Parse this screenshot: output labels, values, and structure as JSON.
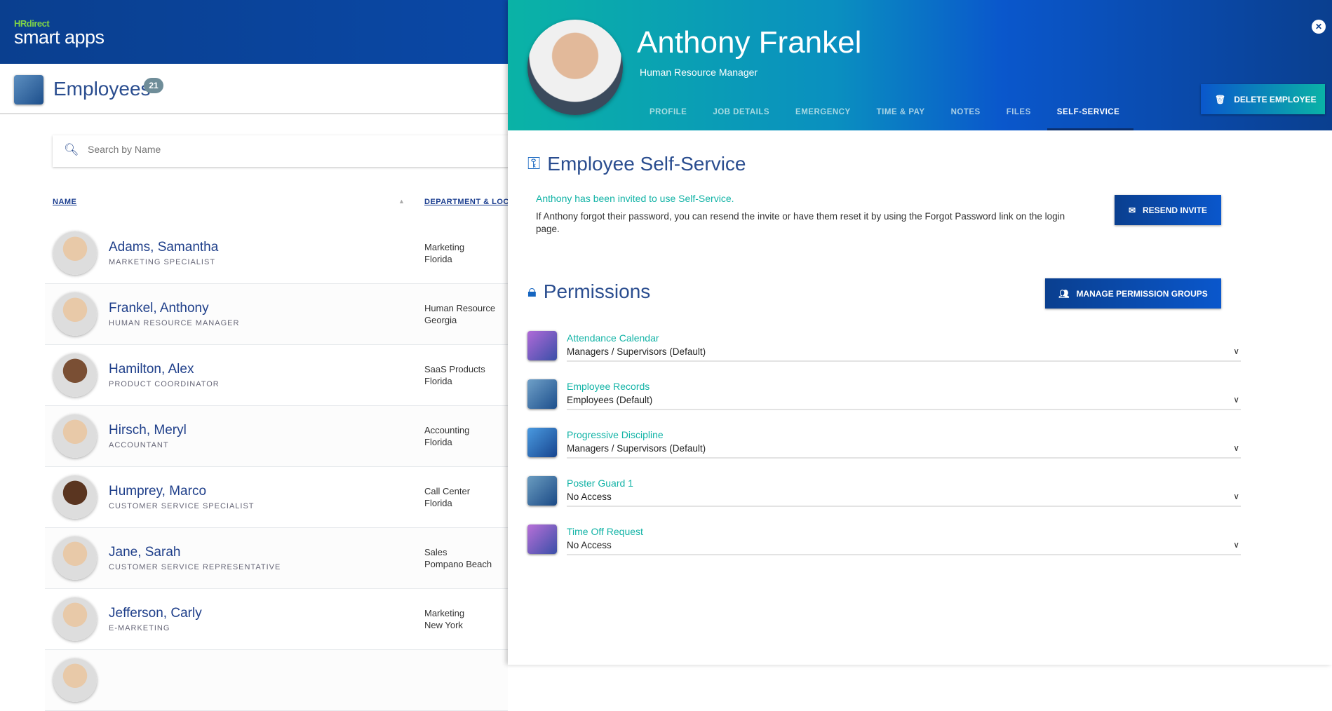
{
  "app": {
    "logo_brand": "HRdirect",
    "logo_product": "smart apps"
  },
  "page": {
    "title": "Employees",
    "count": "21",
    "search_placeholder": "Search by Name",
    "columns": {
      "name": "NAME",
      "department": "DEPARTMENT & LOCATION"
    }
  },
  "employees": [
    {
      "name": "Adams, Samantha",
      "title": "MARKETING SPECIALIST",
      "department": "Marketing",
      "location": "Florida"
    },
    {
      "name": "Frankel, Anthony",
      "title": "HUMAN RESOURCE MANAGER",
      "department": "Human Resource",
      "location": "Georgia"
    },
    {
      "name": "Hamilton, Alex",
      "title": "PRODUCT COORDINATOR",
      "department": "SaaS Products",
      "location": "Florida"
    },
    {
      "name": "Hirsch, Meryl",
      "title": "ACCOUNTANT",
      "department": "Accounting",
      "location": "Florida"
    },
    {
      "name": "Humprey, Marco",
      "title": "CUSTOMER SERVICE SPECIALIST",
      "department": "Call Center",
      "location": "Florida"
    },
    {
      "name": "Jane, Sarah",
      "title": "CUSTOMER SERVICE REPRESENTATIVE",
      "department": "Sales",
      "location": "Pompano Beach"
    },
    {
      "name": "Jefferson, Carly",
      "title": "E-MARKETING",
      "department": "Marketing",
      "location": "New York"
    }
  ],
  "panel": {
    "name": "Anthony Frankel",
    "title": "Human Resource Manager",
    "tabs": [
      "PROFILE",
      "JOB DETAILS",
      "EMERGENCY",
      "TIME & PAY",
      "NOTES",
      "FILES",
      "SELF-SERVICE"
    ],
    "active_tab": "SELF-SERVICE",
    "delete_label": "DELETE EMPLOYEE",
    "self_service": {
      "heading": "Employee Self-Service",
      "status": "Anthony has been invited to use Self-Service.",
      "help": "If Anthony forgot their password, you can resend the invite or have them reset it by using the Forgot Password link on the login page.",
      "resend_label": "RESEND INVITE"
    },
    "permissions": {
      "heading": "Permissions",
      "manage_label": "MANAGE PERMISSION GROUPS",
      "items": [
        {
          "app": "Attendance Calendar",
          "value": "Managers / Supervisors (Default)",
          "color": "#8e44c9"
        },
        {
          "app": "Employee Records",
          "value": "Employees (Default)",
          "color": "#3a78b0"
        },
        {
          "app": "Progressive Discipline",
          "value": "Managers / Supervisors (Default)",
          "color": "#1f6fd0"
        },
        {
          "app": "Poster Guard 1",
          "value": "No Access",
          "color": "#2f6aa8"
        },
        {
          "app": "Time Off Request",
          "value": "No Access",
          "color": "#9a45c4"
        }
      ]
    }
  }
}
